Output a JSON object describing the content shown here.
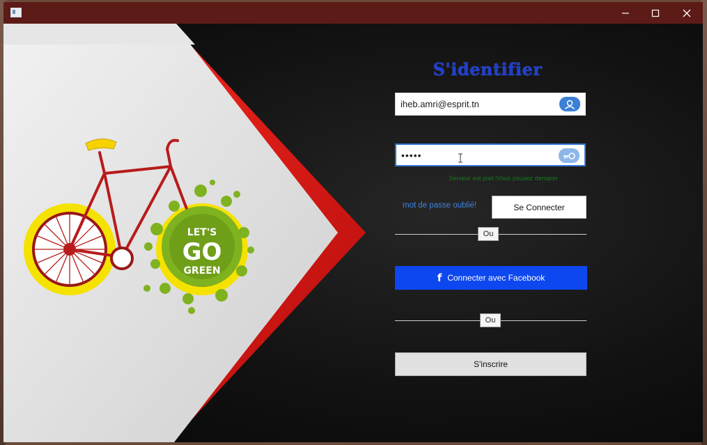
{
  "login": {
    "title": "S'identifier",
    "email_value": "iheb.amri@esprit.tn",
    "password_value": "•••••",
    "status_text": "Serveur est pret !Vous pouvez demarer",
    "forgot_label": "mot de passe oublié!",
    "connect_label": "Se Connecter",
    "separator_1": "Ou",
    "facebook_icon": "facebook-f-icon",
    "facebook_label": "Connecter avec Facebook",
    "separator_2": "Ou",
    "signup_label": "S'inscrire"
  },
  "illustration": {
    "badge_line1": "LET'S",
    "badge_line2": "GO",
    "badge_line3": "GREEN"
  },
  "icons": {
    "user": "user-icon",
    "key": "key-icon",
    "minimize": "minimize-icon",
    "maximize": "maximize-icon",
    "close": "close-icon"
  },
  "colors": {
    "accent": "#1f3fd1",
    "facebook": "#0d47f0",
    "titlebar": "#5d1b17",
    "status": "#177a1d",
    "illustration_red": "#e01b1b"
  }
}
